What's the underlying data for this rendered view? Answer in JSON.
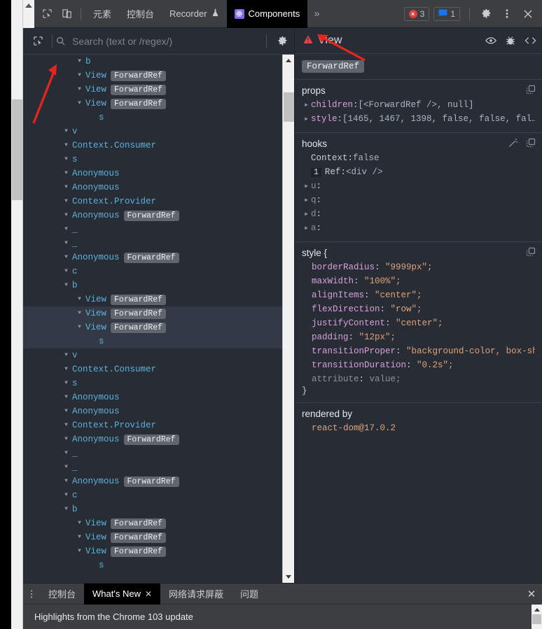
{
  "toolbar": {
    "inspect_icon": "inspect-element-icon",
    "device_icon": "device-toolbar-icon",
    "tabs": [
      {
        "label": "元素",
        "active": false,
        "icon": null
      },
      {
        "label": "控制台",
        "active": false,
        "icon": null
      },
      {
        "label": "Recorder",
        "active": false,
        "icon": "flask-icon"
      },
      {
        "label": "Components",
        "active": true,
        "icon": "react-logo-icon"
      }
    ],
    "more_tabs_label": "»",
    "error_count": "3",
    "message_count": "1",
    "error_dot": "×",
    "settings_icon": "gear-icon",
    "kebab_icon": "more-vertical-icon",
    "close_icon": "close-icon"
  },
  "search": {
    "select_icon": "select-element-icon",
    "search_icon": "search-icon",
    "placeholder": "Search (text or /regex/)",
    "value": "",
    "settings_icon": "gear-icon"
  },
  "tree": {
    "rows": [
      {
        "depth": 3,
        "name": "b",
        "hoc": null,
        "arrow": true,
        "selected": false
      },
      {
        "depth": 3,
        "name": "View",
        "hoc": "ForwardRef",
        "arrow": true,
        "selected": false
      },
      {
        "depth": 3,
        "name": "View",
        "hoc": "ForwardRef",
        "arrow": true,
        "selected": false
      },
      {
        "depth": 3,
        "name": "View",
        "hoc": "ForwardRef",
        "arrow": true,
        "selected": false
      },
      {
        "depth": 4,
        "name": "s",
        "hoc": null,
        "arrow": false,
        "selected": false
      },
      {
        "depth": 2,
        "name": "v",
        "hoc": null,
        "arrow": true,
        "selected": false
      },
      {
        "depth": 2,
        "name": "Context.Consumer",
        "hoc": null,
        "arrow": true,
        "selected": false
      },
      {
        "depth": 2,
        "name": "s",
        "hoc": null,
        "arrow": true,
        "selected": false
      },
      {
        "depth": 2,
        "name": "Anonymous",
        "hoc": null,
        "arrow": true,
        "selected": false
      },
      {
        "depth": 2,
        "name": "Anonymous",
        "hoc": null,
        "arrow": true,
        "selected": false
      },
      {
        "depth": 2,
        "name": "Context.Provider",
        "hoc": null,
        "arrow": true,
        "selected": false
      },
      {
        "depth": 2,
        "name": "Anonymous",
        "hoc": "ForwardRef",
        "arrow": true,
        "selected": false
      },
      {
        "depth": 2,
        "name": "_",
        "hoc": null,
        "arrow": true,
        "selected": false
      },
      {
        "depth": 2,
        "name": "_",
        "hoc": null,
        "arrow": true,
        "selected": false
      },
      {
        "depth": 2,
        "name": "Anonymous",
        "hoc": "ForwardRef",
        "arrow": true,
        "selected": false
      },
      {
        "depth": 2,
        "name": "c",
        "hoc": null,
        "arrow": true,
        "selected": false
      },
      {
        "depth": 2,
        "name": "b",
        "hoc": null,
        "arrow": true,
        "selected": false
      },
      {
        "depth": 3,
        "name": "View",
        "hoc": "ForwardRef",
        "arrow": true,
        "selected": false
      },
      {
        "depth": 3,
        "name": "View",
        "hoc": "ForwardRef",
        "arrow": true,
        "selected": true
      },
      {
        "depth": 3,
        "name": "View",
        "hoc": "ForwardRef",
        "arrow": true,
        "selected": true
      },
      {
        "depth": 4,
        "name": "s",
        "hoc": null,
        "arrow": false,
        "selected": true
      },
      {
        "depth": 2,
        "name": "v",
        "hoc": null,
        "arrow": true,
        "selected": false
      },
      {
        "depth": 2,
        "name": "Context.Consumer",
        "hoc": null,
        "arrow": true,
        "selected": false
      },
      {
        "depth": 2,
        "name": "s",
        "hoc": null,
        "arrow": true,
        "selected": false
      },
      {
        "depth": 2,
        "name": "Anonymous",
        "hoc": null,
        "arrow": true,
        "selected": false
      },
      {
        "depth": 2,
        "name": "Anonymous",
        "hoc": null,
        "arrow": true,
        "selected": false
      },
      {
        "depth": 2,
        "name": "Context.Provider",
        "hoc": null,
        "arrow": true,
        "selected": false
      },
      {
        "depth": 2,
        "name": "Anonymous",
        "hoc": "ForwardRef",
        "arrow": true,
        "selected": false
      },
      {
        "depth": 2,
        "name": "_",
        "hoc": null,
        "arrow": true,
        "selected": false
      },
      {
        "depth": 2,
        "name": "_",
        "hoc": null,
        "arrow": true,
        "selected": false
      },
      {
        "depth": 2,
        "name": "Anonymous",
        "hoc": "ForwardRef",
        "arrow": true,
        "selected": false
      },
      {
        "depth": 2,
        "name": "c",
        "hoc": null,
        "arrow": true,
        "selected": false
      },
      {
        "depth": 2,
        "name": "b",
        "hoc": null,
        "arrow": true,
        "selected": false
      },
      {
        "depth": 3,
        "name": "View",
        "hoc": "ForwardRef",
        "arrow": true,
        "selected": false
      },
      {
        "depth": 3,
        "name": "View",
        "hoc": "ForwardRef",
        "arrow": true,
        "selected": false
      },
      {
        "depth": 3,
        "name": "View",
        "hoc": "ForwardRef",
        "arrow": true,
        "selected": false
      },
      {
        "depth": 4,
        "name": "s",
        "hoc": null,
        "arrow": false,
        "selected": false
      }
    ]
  },
  "inspector": {
    "warning_icon": "warning-triangle-icon",
    "title": "View",
    "actions": [
      {
        "icon": "eye-icon",
        "name": "inspect-dom-icon"
      },
      {
        "icon": "bug-icon",
        "name": "log-to-console-icon"
      },
      {
        "icon": "code-icon",
        "name": "view-source-icon"
      }
    ],
    "chip": "ForwardRef",
    "props": {
      "title": "props",
      "copy_icon": "copy-icon",
      "items": [
        {
          "expandable": true,
          "key": "children",
          "sep": ": ",
          "value": "[<ForwardRef />, null]",
          "value_kind": "plain"
        },
        {
          "expandable": true,
          "key": "style",
          "sep": ": ",
          "value": "[1465, 1467, 1398, false, false, fal…",
          "value_kind": "plain"
        }
      ]
    },
    "hooks": {
      "title": "hooks",
      "edit_icon": "magic-wand-icon",
      "copy_icon": "copy-icon",
      "items": [
        {
          "index": null,
          "expandable": false,
          "key": "Context",
          "sep": ": ",
          "value": "false",
          "value_kind": "plain"
        },
        {
          "index": "1",
          "expandable": false,
          "key": "Ref",
          "sep": ": ",
          "value": "<div />",
          "value_kind": "plain"
        },
        {
          "index": null,
          "expandable": true,
          "key": "u",
          "sep": ":",
          "value": "",
          "value_kind": "dim"
        },
        {
          "index": null,
          "expandable": true,
          "key": "q",
          "sep": ":",
          "value": "",
          "value_kind": "dim"
        },
        {
          "index": null,
          "expandable": true,
          "key": "d",
          "sep": ":",
          "value": "",
          "value_kind": "dim"
        },
        {
          "index": null,
          "expandable": true,
          "key": "a",
          "sep": ":",
          "value": "",
          "value_kind": "dim"
        }
      ]
    },
    "style": {
      "title": "style {",
      "copy_icon": "copy-icon",
      "close_brace": "}",
      "declarations": [
        {
          "prop": "borderRadius",
          "value": "\"9999px\";",
          "dim": false
        },
        {
          "prop": "maxWidth",
          "value": "\"100%\";",
          "dim": false
        },
        {
          "prop": "alignItems",
          "value": "\"center\";",
          "dim": false
        },
        {
          "prop": "flexDirection",
          "value": "\"row\";",
          "dim": false
        },
        {
          "prop": "justifyContent",
          "value": "\"center\";",
          "dim": false
        },
        {
          "prop": "padding",
          "value": "\"12px\";",
          "dim": false
        },
        {
          "prop": "transitionProper",
          "value": "\"background-color, box-sha;",
          "dim": false
        },
        {
          "prop": "transitionDuration",
          "value": "\"0.2s\";",
          "dim": false
        },
        {
          "prop": "attribute",
          "value": "value;",
          "dim": true
        }
      ]
    },
    "rendered_by": {
      "title": "rendered by",
      "value": "react-dom@17.0.2"
    }
  },
  "drawer": {
    "kebab_icon": "more-vertical-icon",
    "tabs": [
      {
        "label": "控制台",
        "active": false,
        "closable": false
      },
      {
        "label": "What's New",
        "active": true,
        "closable": true
      },
      {
        "label": "网络请求屏蔽",
        "active": false,
        "closable": false
      },
      {
        "label": "问题",
        "active": false,
        "closable": false
      }
    ],
    "close_label": "✕",
    "content": "Highlights from the Chrome 103 update"
  },
  "colors": {
    "panel_bg": "#282c34",
    "toolbar_bg": "#3c3f41",
    "component_name": "#5bb1dd",
    "accent_purple": "#7b68ee",
    "error_red": "#e23c3c",
    "annotation_red": "#e8241f",
    "string_orange": "#e0a37a",
    "prop_purple": "#d8a0df",
    "selection_bg": "#343a45"
  }
}
